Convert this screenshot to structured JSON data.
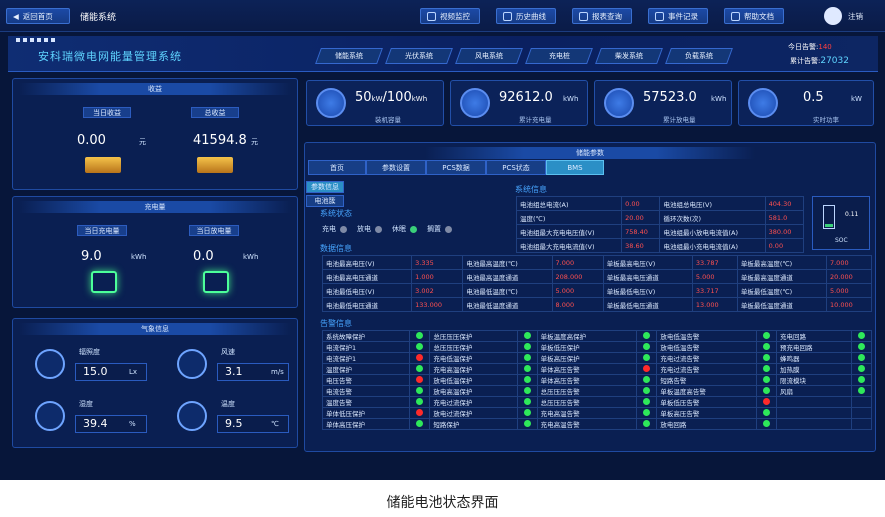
{
  "topbar": {
    "back": "返回首页",
    "title": "储能系统",
    "buttons": [
      "视频监控",
      "历史曲线",
      "报表查询",
      "事件记录",
      "帮助文档"
    ],
    "user": "注销"
  },
  "system_title": "安科瑞微电网能量管理系统",
  "nav_tabs": [
    "储能系统",
    "光伏系统",
    "风电系统",
    "充电桩",
    "柴发系统",
    "负载系统"
  ],
  "alarms": {
    "today_label": "今日告警:",
    "today": "140",
    "total_label": "累计告警:",
    "total": "27032"
  },
  "income": {
    "title": "收益",
    "today_label": "当日收益",
    "total_label": "总收益",
    "today": "0.00",
    "total": "41594.8",
    "unit": "元"
  },
  "charge": {
    "title": "充电量",
    "charge_label": "当日充电量",
    "discharge_label": "当日放电量",
    "charge": "9.0",
    "discharge": "0.0",
    "unit": "kWh"
  },
  "weather": {
    "title": "气象信息",
    "items": [
      {
        "label": "辐照度",
        "value": "15.0",
        "unit": "Lx",
        "icon": "sun-icon"
      },
      {
        "label": "风速",
        "value": "3.1",
        "unit": "m/s",
        "icon": "fan-icon"
      },
      {
        "label": "湿度",
        "value": "39.4",
        "unit": "%",
        "icon": "droplet-icon"
      },
      {
        "label": "温度",
        "value": "9.5",
        "unit": "℃",
        "icon": "thermometer-icon"
      }
    ]
  },
  "stats": [
    {
      "value": "50",
      "unit_mid": "kW",
      "value2": "/100",
      "unit": "kWh",
      "label": "装机容量"
    },
    {
      "value": "92612.0",
      "unit": "kWh",
      "label": "累计充电量"
    },
    {
      "value": "57523.0",
      "unit": "kWh",
      "label": "累计放电量"
    },
    {
      "value": "0.5",
      "unit": "kW",
      "label": "实时功率"
    }
  ],
  "bms": {
    "title": "储能参数",
    "tabs": [
      "首页",
      "参数设置",
      "PCS数据",
      "PCS状态",
      "BMS"
    ],
    "side_tabs": [
      "参数信息",
      "电池簇"
    ],
    "status_title": "系统状态",
    "status": [
      {
        "label": "充电",
        "color": "#7f8aa6"
      },
      {
        "label": "放电",
        "color": "#7f8aa6"
      },
      {
        "label": "休眠",
        "color": "#3ad07a"
      },
      {
        "label": "搁置",
        "color": "#7f8aa6"
      }
    ],
    "sysinfo_title": "系统信息",
    "sysinfo": [
      [
        "电池组总电流(A)",
        "0.00",
        "电池组总电压(V)",
        "404.30"
      ],
      [
        "温度(℃)",
        "20.00",
        "循环次数(次)",
        "581.0"
      ],
      [
        "电池组最大充电电压值(V)",
        "758.40",
        "电池组最小放电电流值(A)",
        "380.00"
      ],
      [
        "电池组最大充电电流值(V)",
        "38.60",
        "电池组最小充电电流值(A)",
        "0.00"
      ]
    ],
    "soc": {
      "value": "0.11",
      "label": "SOC"
    },
    "data_title": "数据信息",
    "data": [
      [
        "电池最高电压(V)",
        "3.335",
        "电池最高温度(℃)",
        "7.000",
        "单板最高电压(V)",
        "33.787",
        "单板最高温度(℃)",
        "7.000"
      ],
      [
        "电池最高电压通道",
        "1.000",
        "电池最高温度通道",
        "208.000",
        "单板最高电压通道",
        "5.000",
        "单板最高温度通道",
        "20.000"
      ],
      [
        "电池最低电压(V)",
        "3.002",
        "电池最低温度(℃)",
        "5.000",
        "单板最低电压(V)",
        "33.717",
        "单板最低温度(℃)",
        "5.000"
      ],
      [
        "电池最低电压通道",
        "133.000",
        "电池最低温度通道",
        "8.000",
        "单板最低电压通道",
        "13.000",
        "单板最低温度通道",
        "10.000"
      ]
    ],
    "alarm_title": "告警信息",
    "alarms": [
      [
        [
          "系统故障保护",
          "g"
        ],
        [
          "总压压压保护",
          "g"
        ],
        [
          "单板温度高保护",
          "g"
        ],
        [
          "放电低温告警",
          "g"
        ],
        [
          "充电回路",
          "g"
        ]
      ],
      [
        [
          "电流保护1",
          "g"
        ],
        [
          "总压压压保护",
          "g"
        ],
        [
          "单板低压保护",
          "g"
        ],
        [
          "放电低温告警",
          "g"
        ],
        [
          "预充电回路",
          "g"
        ]
      ],
      [
        [
          "电流保护1",
          "r"
        ],
        [
          "充电低温保护",
          "g"
        ],
        [
          "单板高压保护",
          "g"
        ],
        [
          "充电过流告警",
          "g"
        ],
        [
          "蜂鸣器",
          "g"
        ]
      ],
      [
        [
          "温度保护",
          "g"
        ],
        [
          "充电高温保护",
          "g"
        ],
        [
          "单体高压告警",
          "r"
        ],
        [
          "充电过流告警",
          "g"
        ],
        [
          "加热膜",
          "g"
        ]
      ],
      [
        [
          "电压告警",
          "r"
        ],
        [
          "放电低温保护",
          "g"
        ],
        [
          "单体高压告警",
          "g"
        ],
        [
          "短路告警",
          "g"
        ],
        [
          "限流模块",
          "g"
        ]
      ],
      [
        [
          "电流告警",
          "g"
        ],
        [
          "放电高温保护",
          "g"
        ],
        [
          "总压压压告警",
          "g"
        ],
        [
          "单板温度高告警",
          "g"
        ],
        [
          "风扇",
          "g"
        ]
      ],
      [
        [
          "温度告警",
          "g"
        ],
        [
          "充电过流保护",
          "g"
        ],
        [
          "总压压压告警",
          "g"
        ],
        [
          "单板低压告警",
          "r"
        ],
        [
          "",
          ""
        ]
      ],
      [
        [
          "单体低压保护",
          "r"
        ],
        [
          "放电过流保护",
          "g"
        ],
        [
          "充电高温告警",
          "g"
        ],
        [
          "单板高压告警",
          "g"
        ],
        [
          "",
          ""
        ]
      ],
      [
        [
          "单体高压保护",
          "g"
        ],
        [
          "短路保护",
          "g"
        ],
        [
          "充电高温告警",
          "g"
        ],
        [
          "放电回路",
          "g"
        ],
        [
          "",
          ""
        ]
      ]
    ]
  },
  "caption": "储能电池状态界面"
}
